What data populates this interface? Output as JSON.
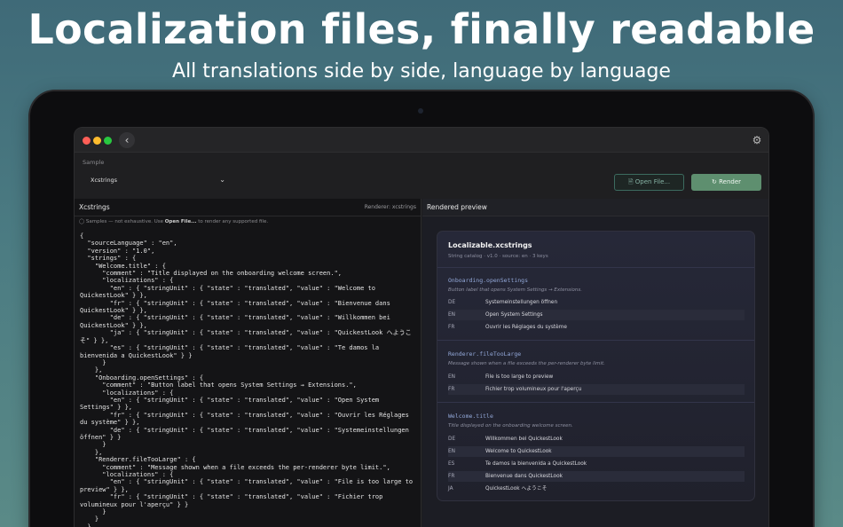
{
  "hero": {
    "title": "Localization files, finally readable",
    "subtitle": "All translations side by side, language by language"
  },
  "window": {
    "back_icon": "chevron-left-icon",
    "settings_icon": "gear-icon"
  },
  "toolbar": {
    "sample_label": "Sample",
    "sample_value": "Xcstrings",
    "open_label": "Open File...",
    "render_label": "Render"
  },
  "left_pane": {
    "title": "Xcstrings",
    "renderer": "Renderer: xcstrings",
    "hint_prefix": "Samples — not exhaustive. Use",
    "hint_bold": "Open File...",
    "hint_suffix": "to render any supported file.",
    "code": "{\n  \"sourceLanguage\" : \"en\",\n  \"version\" : \"1.0\",\n  \"strings\" : {\n    \"Welcome.title\" : {\n      \"comment\" : \"Title displayed on the onboarding welcome screen.\",\n      \"localizations\" : {\n        \"en\" : { \"stringUnit\" : { \"state\" : \"translated\", \"value\" : \"Welcome to\nQuickestLook\" } },\n        \"fr\" : { \"stringUnit\" : { \"state\" : \"translated\", \"value\" : \"Bienvenue dans\nQuickestLook\" } },\n        \"de\" : { \"stringUnit\" : { \"state\" : \"translated\", \"value\" : \"Willkommen bei\nQuickestLook\" } },\n        \"ja\" : { \"stringUnit\" : { \"state\" : \"translated\", \"value\" : \"QuickestLook へようこ\nそ\" } },\n        \"es\" : { \"stringUnit\" : { \"state\" : \"translated\", \"value\" : \"Te damos la\nbienvenida a QuickestLook\" } }\n      }\n    },\n    \"Onboarding.openSettings\" : {\n      \"comment\" : \"Button label that opens System Settings → Extensions.\",\n      \"localizations\" : {\n        \"en\" : { \"stringUnit\" : { \"state\" : \"translated\", \"value\" : \"Open System\nSettings\" } },\n        \"fr\" : { \"stringUnit\" : { \"state\" : \"translated\", \"value\" : \"Ouvrir les Réglages\ndu système\" } },\n        \"de\" : { \"stringUnit\" : { \"state\" : \"translated\", \"value\" : \"Systemeinstellungen\nöffnen\" } }\n      }\n    },\n    \"Renderer.fileTooLarge\" : {\n      \"comment\" : \"Message shown when a file exceeds the per-renderer byte limit.\",\n      \"localizations\" : {\n        \"en\" : { \"stringUnit\" : { \"state\" : \"translated\", \"value\" : \"File is too large to\npreview\" } },\n        \"fr\" : { \"stringUnit\" : { \"state\" : \"translated\", \"value\" : \"Fichier trop\nvolumineux pour l'aperçu\" } }\n      }\n    }\n  }\n}"
  },
  "right_pane": {
    "title": "Rendered preview",
    "card_title": "Localizable.xcstrings",
    "card_meta": "String catalog · v1.0 · source: en · 3 keys",
    "groups": [
      {
        "key": "Onboarding.openSettings",
        "desc": "Button label that opens System Settings → Extensions.",
        "rows": [
          {
            "lang": "DE",
            "value": "Systemeinstellungen öffnen"
          },
          {
            "lang": "EN",
            "value": "Open System Settings"
          },
          {
            "lang": "FR",
            "value": "Ouvrir les Réglages du système"
          }
        ]
      },
      {
        "key": "Renderer.fileTooLarge",
        "desc": "Message shown when a file exceeds the per-renderer byte limit.",
        "rows": [
          {
            "lang": "EN",
            "value": "File is too large to preview"
          },
          {
            "lang": "FR",
            "value": "Fichier trop volumineux pour l'aperçu"
          }
        ]
      },
      {
        "key": "Welcome.title",
        "desc": "Title displayed on the onboarding welcome screen.",
        "rows": [
          {
            "lang": "DE",
            "value": "Willkommen bei QuickestLook"
          },
          {
            "lang": "EN",
            "value": "Welcome to QuickestLook"
          },
          {
            "lang": "ES",
            "value": "Te damos la bienvenida a QuickestLook"
          },
          {
            "lang": "FR",
            "value": "Bienvenue dans QuickestLook"
          },
          {
            "lang": "JA",
            "value": "QuickestLook へようこそ"
          }
        ]
      }
    ]
  },
  "colors": {
    "accent_green": "#5e8f6f",
    "key_blue": "#93a8d9"
  }
}
